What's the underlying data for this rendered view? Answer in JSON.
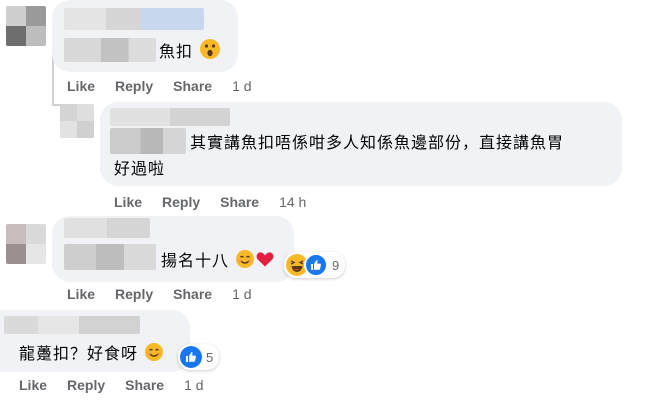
{
  "actions": {
    "like": "Like",
    "reply": "Reply",
    "share": "Share"
  },
  "comments": [
    {
      "text": "魚扣",
      "time": "1 d"
    },
    {
      "text_line1": "其實講魚扣唔係咁多人知係魚邊部份，直接講魚胃",
      "text_line2": "好過啦",
      "time": "14 h"
    },
    {
      "text": "揚名十八",
      "time": "1 d",
      "reaction_count": "9"
    },
    {
      "text": "龍躉扣？好食呀",
      "time": "1 d",
      "reaction_count": "5"
    }
  ],
  "colors": {
    "bubble": "#f0f2f5",
    "action_text": "#65676b",
    "like_blue": "#1877f2",
    "heart_red": "#e41e3f",
    "haha_yellow": "#f7b928"
  },
  "icons": [
    "surprised-emoji-icon",
    "smiling-emoji-icon",
    "red-heart-icon",
    "haha-reaction-icon",
    "like-reaction-icon"
  ]
}
